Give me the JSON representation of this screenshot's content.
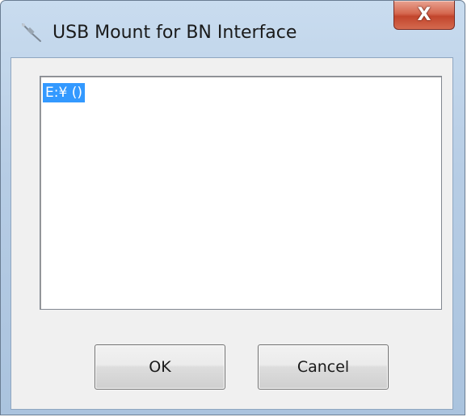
{
  "window": {
    "title": "USB Mount for BN Interface",
    "icon": "usb-plug-icon",
    "close_glyph": "X"
  },
  "listbox": {
    "items": [
      {
        "label": "E:¥ ()",
        "selected": true
      }
    ]
  },
  "buttons": {
    "ok_label": "OK",
    "cancel_label": "Cancel"
  },
  "colors": {
    "selection": "#3399ff",
    "close_button": "#c9452c",
    "frame": "#b7cde5"
  }
}
